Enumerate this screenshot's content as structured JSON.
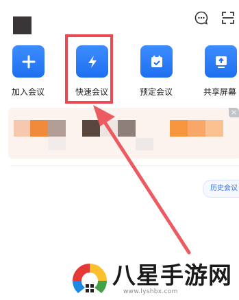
{
  "toolbar": {
    "actions": [
      {
        "label": "加入会议",
        "icon": "plus-icon"
      },
      {
        "label": "快速会议",
        "icon": "lightning-icon"
      },
      {
        "label": "预定会议",
        "icon": "calendar-check-icon"
      },
      {
        "label": "共享屏幕",
        "icon": "share-screen-icon"
      }
    ]
  },
  "top_icons": [
    "chat-icon",
    "scan-icon"
  ],
  "banner": {
    "close_label": "×"
  },
  "history_button": {
    "label": "历史会议"
  },
  "watermark": {
    "brand": "八星手游网",
    "url": "www.lyshbx.com"
  },
  "colors": {
    "accent_blue": "#1e6ff0",
    "highlight_red": "#e94a52"
  }
}
